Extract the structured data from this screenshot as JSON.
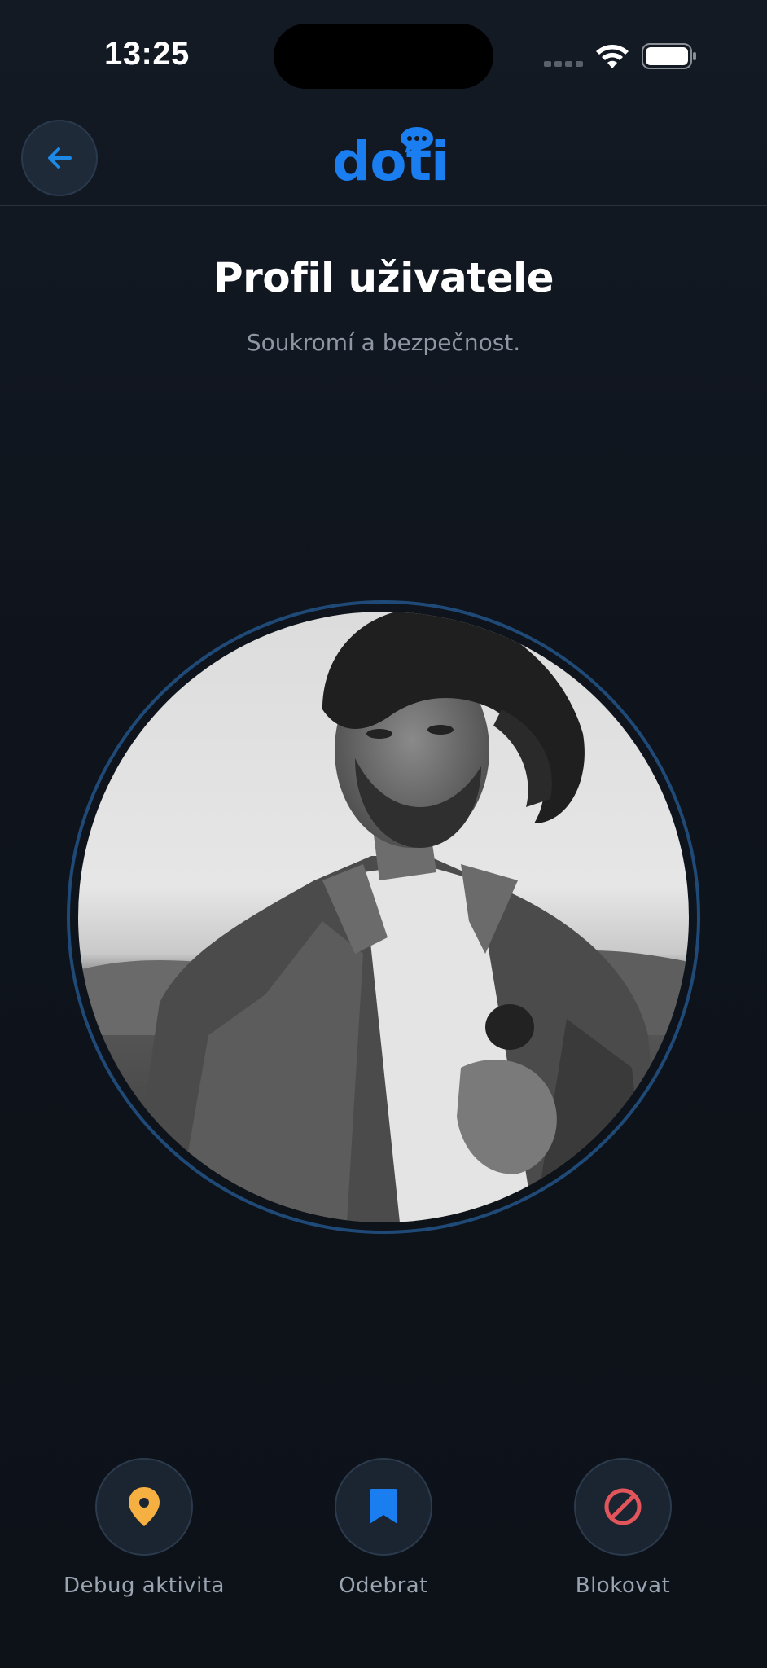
{
  "status_bar": {
    "time": "13:25"
  },
  "header": {
    "logo_text": "doti",
    "back_icon": "arrow-left-icon",
    "accent_color": "#1a7df0"
  },
  "page": {
    "title": "Profil uživatele",
    "subtitle": "Soukromí a bezpečnost."
  },
  "profile": {
    "photo": "black-and-white portrait of a man in a denim jacket"
  },
  "actions": [
    {
      "label": "Debug aktivita",
      "icon": "location-pin-icon",
      "color": "#f5b041"
    },
    {
      "label": "Odebrat",
      "icon": "bookmark-icon",
      "color": "#1a7df0"
    },
    {
      "label": "Blokovat",
      "icon": "block-icon",
      "color": "#e2555a"
    }
  ]
}
